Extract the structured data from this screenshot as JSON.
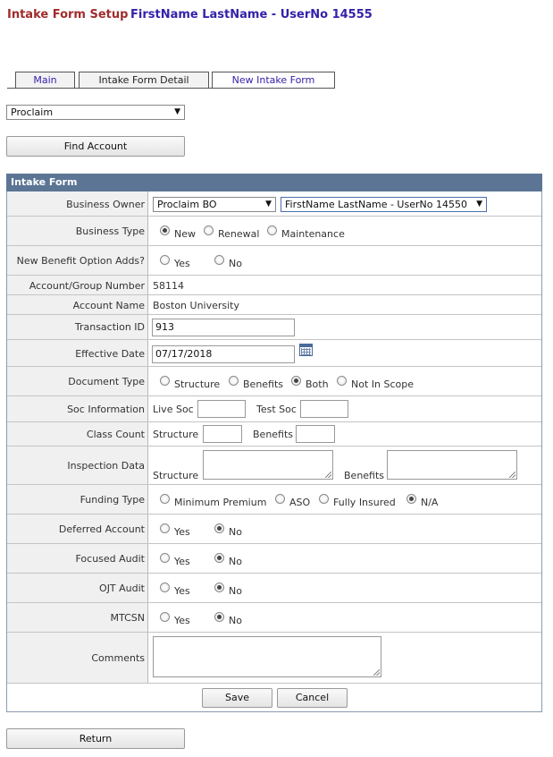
{
  "header": {
    "title": "Intake Form Setup",
    "user": "FirstName LastName - UserNo 14555"
  },
  "tabs": [
    {
      "label": "Main"
    },
    {
      "label": "Intake Form Detail"
    },
    {
      "label": "New Intake Form"
    }
  ],
  "top": {
    "company_select": "Proclaim",
    "find_button": "Find Account"
  },
  "form": {
    "title": "Intake Form",
    "business_owner": {
      "label": "Business Owner",
      "select1": "Proclaim BO",
      "select2": "FirstName LastName - UserNo 14550"
    },
    "business_type": {
      "label": "Business Type",
      "options": [
        "New",
        "Renewal",
        "Maintenance"
      ],
      "selected": "New"
    },
    "new_benefit": {
      "label": "New Benefit Option Adds?",
      "options": [
        "Yes",
        "No"
      ],
      "selected": ""
    },
    "account_group": {
      "label": "Account/Group Number",
      "value": "58114"
    },
    "account_name": {
      "label": "Account Name",
      "value": "Boston University"
    },
    "transaction_id": {
      "label": "Transaction ID",
      "value": "913"
    },
    "effective_date": {
      "label": "Effective Date",
      "value": "07/17/2018"
    },
    "document_type": {
      "label": "Document Type",
      "options": [
        "Structure",
        "Benefits",
        "Both",
        "Not In Scope"
      ],
      "selected": "Both"
    },
    "soc_info": {
      "label": "Soc Information",
      "live": "Live Soc",
      "test": "Test Soc"
    },
    "class_count": {
      "label": "Class Count",
      "structure": "Structure",
      "benefits": "Benefits"
    },
    "inspection": {
      "label": "Inspection Data",
      "structure": "Structure",
      "benefits": "Benefits"
    },
    "funding_type": {
      "label": "Funding Type",
      "options": [
        "Minimum Premium",
        "ASO",
        "Fully Insured",
        "N/A"
      ],
      "selected": "N/A"
    },
    "deferred": {
      "label": "Deferred Account",
      "options": [
        "Yes",
        "No"
      ],
      "selected": "No"
    },
    "focused": {
      "label": "Focused Audit",
      "options": [
        "Yes",
        "No"
      ],
      "selected": "No"
    },
    "ojt": {
      "label": "OJT Audit",
      "options": [
        "Yes",
        "No"
      ],
      "selected": "No"
    },
    "mtcsn": {
      "label": "MTCSN",
      "options": [
        "Yes",
        "No"
      ],
      "selected": "No"
    },
    "comments": {
      "label": "Comments"
    },
    "save": "Save",
    "cancel": "Cancel"
  },
  "return_button": "Return",
  "icons": {
    "dropdown": "chevron-down-icon",
    "calendar": "calendar-icon",
    "radio": "radio-icon"
  }
}
